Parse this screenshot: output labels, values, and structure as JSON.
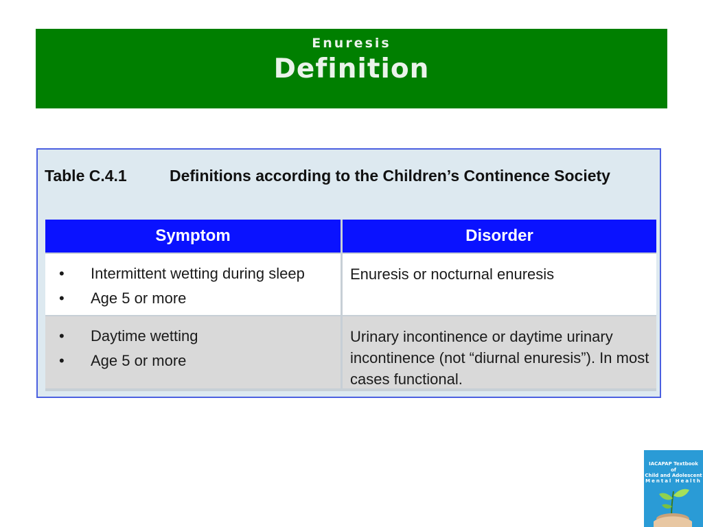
{
  "header": {
    "subtitle": "Enuresis",
    "title": "Definition",
    "color": "#007f00"
  },
  "table": {
    "caption_number": "Table C.4.1",
    "caption_text": "Definitions according to the Children’s Continence Society",
    "columns": [
      "Symptom",
      "Disorder"
    ],
    "header_color": "#0a12ff",
    "rows": [
      {
        "symptoms": [
          "Intermittent wetting during sleep",
          "Age 5 or more"
        ],
        "disorder": "Enuresis or nocturnal enuresis"
      },
      {
        "symptoms": [
          "Daytime wetting",
          "Age 5 or more"
        ],
        "disorder": "Urinary incontinence or daytime urinary incontinence (not “diurnal enuresis”). In most cases functional."
      }
    ]
  },
  "book_cover": {
    "line1": "IACAPAP Textbook",
    "line2": "of",
    "line3": "Child and Adolescent",
    "line4": "Mental Health",
    "icon": "plant-in-hands-icon"
  }
}
